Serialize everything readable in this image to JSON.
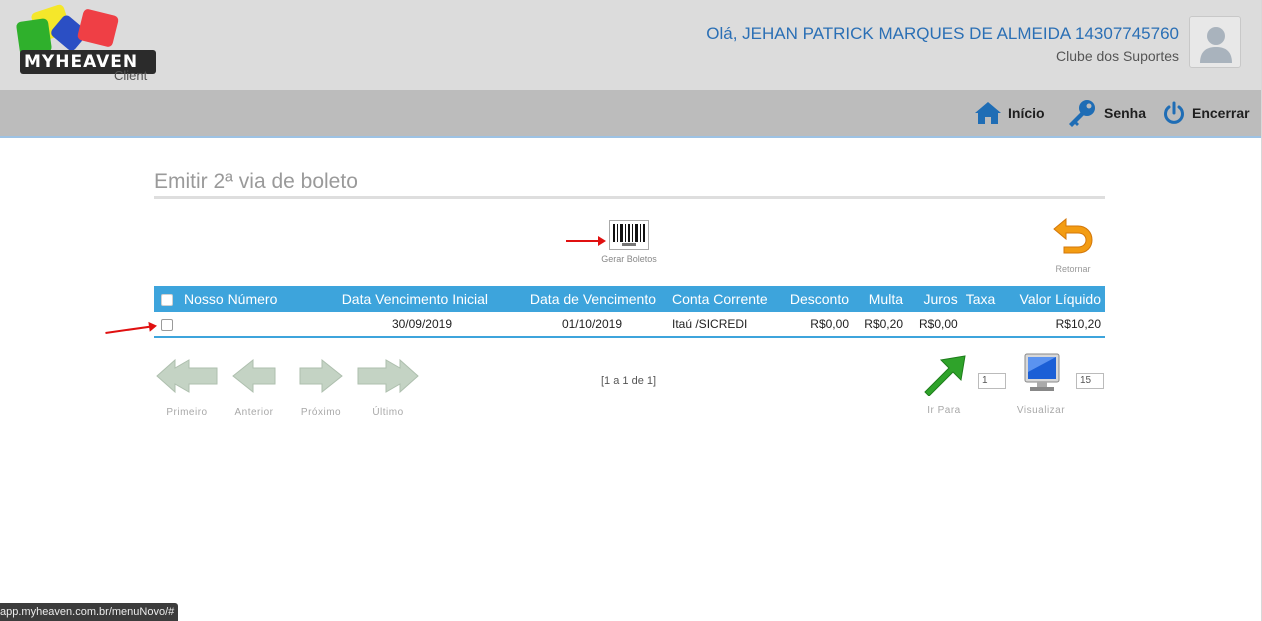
{
  "header": {
    "logo_text": "MYHEAVEN",
    "logo_sub": "Client",
    "greeting": "Olá, JEHAN PATRICK MARQUES DE ALMEIDA 14307745760",
    "organization": "Clube dos Suportes"
  },
  "nav": {
    "home": "Início",
    "password": "Senha",
    "exit": "Encerrar"
  },
  "page": {
    "title": "Emitir 2ª via de boleto",
    "generate_label": "Gerar Boletos",
    "return_label": "Retornar"
  },
  "table": {
    "headers": [
      "Nosso Número",
      "Data Vencimento Inicial",
      "Data de Vencimento",
      "Conta Corrente",
      "Desconto",
      "Multa",
      "Juros",
      "Taxa",
      "Valor Líquido"
    ],
    "rows": [
      {
        "nosso_numero": "",
        "data_vencimento_inicial": "30/09/2019",
        "data_vencimento": "01/10/2019",
        "conta_corrente": "Itaú /SICREDI",
        "desconto": "R$0,00",
        "multa": "R$0,20",
        "juros": "R$0,00",
        "taxa": "",
        "valor_liquido": "R$10,20"
      }
    ]
  },
  "pager": {
    "first": "Primeiro",
    "previous": "Anterior",
    "next": "Próximo",
    "last": "Último",
    "info": "[1 a 1 de 1]",
    "goto_label": "Ir Para",
    "goto_value": "1",
    "view_label": "Visualizar",
    "view_value": "15"
  },
  "status_url": "app.myheaven.com.br/menuNovo/#",
  "colors": {
    "accent": "#3da4dc",
    "link_blue": "#2a6fb5",
    "header_bg": "#dcdcdc",
    "nav_bg": "#bcbcbc"
  }
}
